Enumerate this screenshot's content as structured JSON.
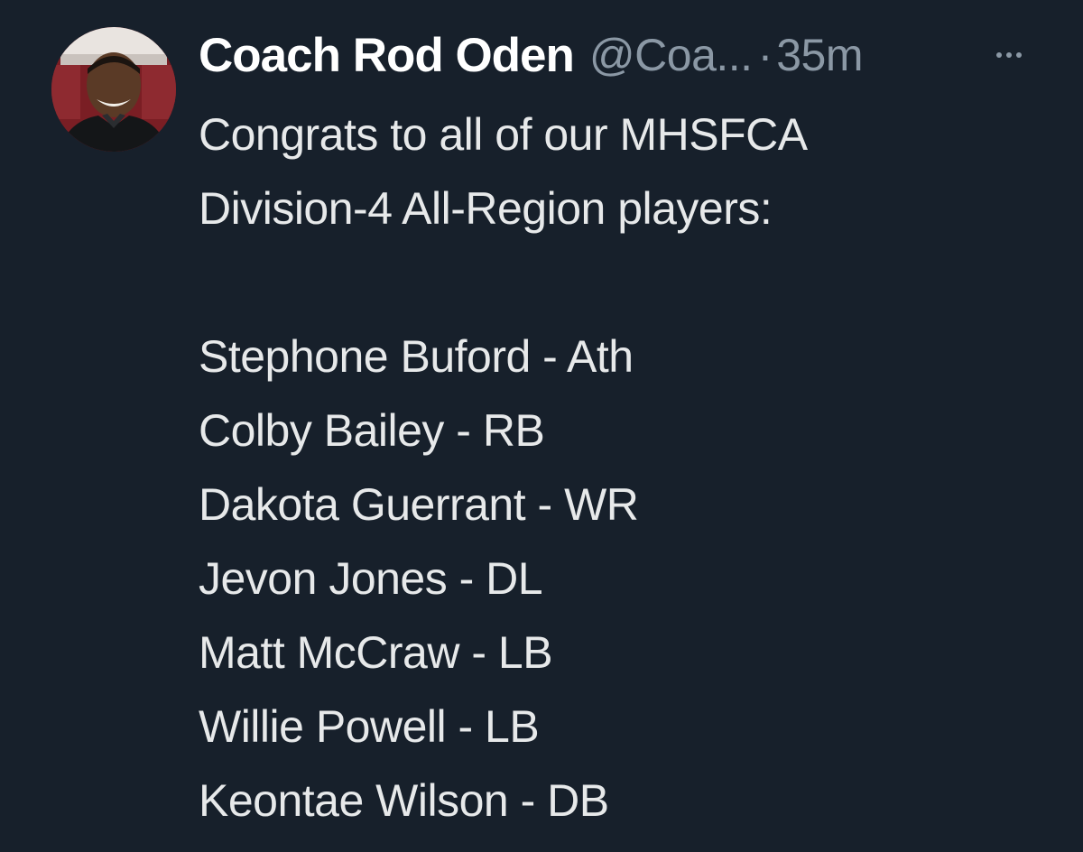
{
  "tweet": {
    "author_name": "Coach Rod Oden",
    "handle": "@Coa...",
    "separator": "·",
    "time": "35m",
    "more_icon": "more-horizontal-icon",
    "intro_lines": [
      "Congrats to all of our MHSFCA",
      "Division-4 All-Region players:"
    ],
    "players": [
      "Stephone Buford - Ath",
      "Colby Bailey - RB",
      "Dakota Guerrant - WR",
      "Jevon Jones - DL",
      "Matt McCraw - LB",
      "Willie Powell - LB",
      "Keontae Wilson - DB"
    ]
  },
  "colors": {
    "background": "#17202b",
    "text": "#e7e9ea",
    "name": "#ffffff",
    "muted": "#8b98a5"
  }
}
